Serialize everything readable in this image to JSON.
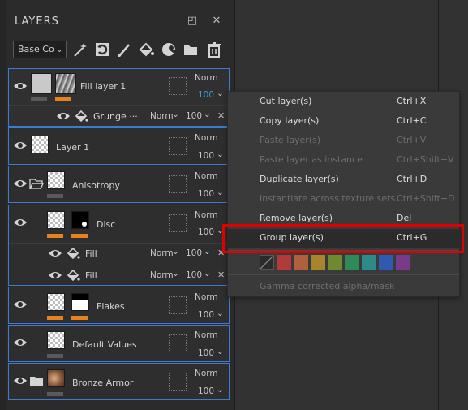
{
  "panel": {
    "title": "LAYERS",
    "icons": [
      "undock-icon",
      "close-icon"
    ],
    "close_glyph": "✕",
    "undock_glyph": "◰",
    "channel_select": {
      "value": "Base Co",
      "chevron": "⌄"
    }
  },
  "toolbar": {
    "tools": [
      "magic-wand-icon",
      "refresh-mask-icon",
      "paint-brush-icon",
      "fill-bucket-icon",
      "smart-material-icon",
      "folder-icon",
      "trash-icon"
    ]
  },
  "layers": [
    {
      "name": "Fill layer 1",
      "blend": "Norm",
      "opacity": "100",
      "opacity_chevron": "⌄",
      "opacity_color": "#3a9ad9"
    },
    {
      "effect": {
        "name": "Grunge ···",
        "blend": "Norm",
        "blend_chev": "⌄",
        "opacity": "100",
        "opacity_chev": "⌄",
        "close": "✕"
      }
    },
    {
      "name": "Layer 1",
      "blend": "Norm",
      "opacity": "100",
      "opacity_chevron": "⌄"
    },
    {
      "name": "Anisotropy",
      "blend": "Norm",
      "opacity": "100",
      "opacity_chevron": "⌄"
    },
    {
      "name": "Disc",
      "blend": "Norm",
      "opacity": "100",
      "opacity_chevron": "⌄"
    },
    {
      "effect": {
        "name": "Fill",
        "blend": "Norm",
        "blend_chev": "⌄",
        "opacity": "100",
        "opacity_chev": "⌄",
        "close": "✕"
      }
    },
    {
      "effect": {
        "name": "Fill",
        "blend": "Norm",
        "blend_chev": "⌄",
        "opacity": "100",
        "opacity_chev": "⌄",
        "close": "✕"
      }
    },
    {
      "name": "Flakes",
      "blend": "Norm",
      "opacity": "100",
      "opacity_chevron": "⌄"
    },
    {
      "name": "Default Values",
      "blend": "Norm",
      "opacity": "100",
      "opacity_chevron": "⌄"
    },
    {
      "name": "Bronze Armor",
      "blend": "Norm",
      "opacity": "100",
      "opacity_chevron": "⌄"
    }
  ],
  "context_menu": {
    "items": [
      {
        "label": "Cut layer(s)",
        "shortcut": "Ctrl+X",
        "enabled": true
      },
      {
        "label": "Copy layer(s)",
        "shortcut": "Ctrl+C",
        "enabled": true
      },
      {
        "label": "Paste layer(s)",
        "shortcut": "Ctrl+V",
        "enabled": false
      },
      {
        "label": "Paste layer as instance",
        "shortcut": "Ctrl+Shift+V",
        "enabled": false
      },
      {
        "label": "Duplicate layer(s)",
        "shortcut": "Ctrl+D",
        "enabled": true
      },
      {
        "label": "Instantiate across texture sets...",
        "shortcut": "Ctrl+Shift+D",
        "enabled": false
      },
      {
        "label": "Remove layer(s)",
        "shortcut": "Del",
        "enabled": true
      },
      {
        "label": "Group layer(s)",
        "shortcut": "Ctrl+G",
        "enabled": true,
        "highlighted": true
      },
      {
        "label": "Gamma corrected alpha/mask",
        "shortcut": "",
        "enabled": false
      }
    ],
    "color_swatches": [
      "#b23a3a",
      "#b0603a",
      "#a8842e",
      "#6f8a2e",
      "#2e8a58",
      "#2e8a86",
      "#2e5ab0",
      "#7a3a8a"
    ],
    "accent_orange": "#e8821e",
    "highlight_outline": "#e00000"
  }
}
